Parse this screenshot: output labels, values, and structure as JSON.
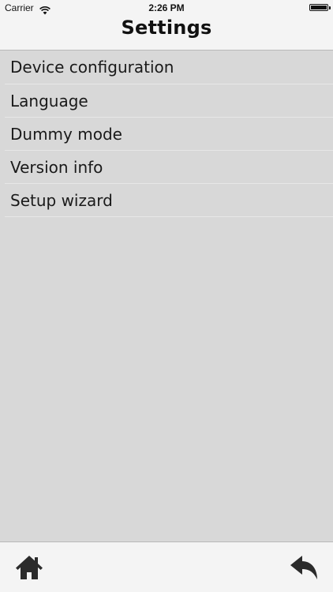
{
  "status_bar": {
    "carrier": "Carrier",
    "time": "2:26 PM",
    "icons": [
      "wifi-icon",
      "battery-icon"
    ]
  },
  "nav_bar": {
    "title": "Settings"
  },
  "settings_list": {
    "items": [
      {
        "label": "Device configuration"
      },
      {
        "label": "Language"
      },
      {
        "label": "Dummy mode"
      },
      {
        "label": "Version info"
      },
      {
        "label": "Setup wizard"
      }
    ]
  },
  "toolbar": {
    "home_icon": "home-icon",
    "back_icon": "reply-back-icon"
  },
  "colors": {
    "background": "#d8d8d8",
    "bar_background": "#f4f4f4",
    "text": "#1a1a1a",
    "icon": "#2b2b2b"
  }
}
